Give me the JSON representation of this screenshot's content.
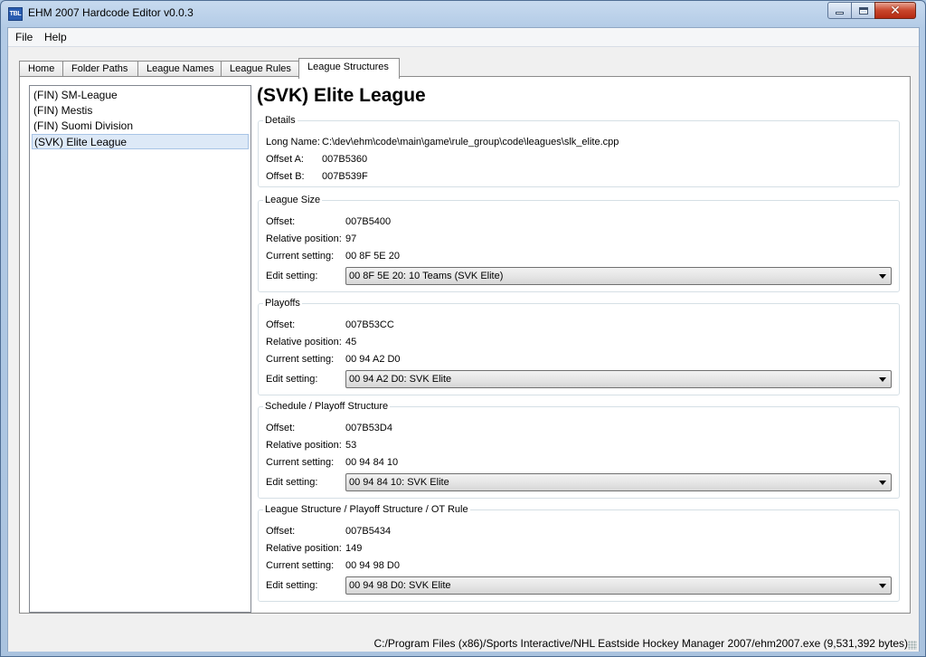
{
  "window": {
    "title": "EHM 2007 Hardcode Editor v0.0.3",
    "icon_name": "tbl-app-icon",
    "icon_text": "TBL"
  },
  "menu": {
    "file": "File",
    "help": "Help"
  },
  "tabs": [
    "Home",
    "Folder Paths",
    "League Names",
    "League Rules",
    "League Structures"
  ],
  "active_tab": "League Structures",
  "leagues": [
    "(FIN) SM-League",
    "(FIN) Mestis",
    "(FIN) Suomi Division",
    "(SVK) Elite League"
  ],
  "selected_league": "(SVK) Elite League",
  "detail": {
    "title": "(SVK) Elite League",
    "details_group": {
      "legend": "Details",
      "long_name_label": "Long Name:",
      "long_name": "C:\\dev\\ehm\\code\\main\\game\\rule_group\\code\\leagues\\slk_elite.cpp",
      "offset_a_label": "Offset A:",
      "offset_a": "007B5360",
      "offset_b_label": "Offset B:",
      "offset_b": "007B539F"
    },
    "labels": {
      "offset": "Offset:",
      "relative_position": "Relative position:",
      "current_setting": "Current setting:",
      "edit_setting": "Edit setting:"
    },
    "groups": [
      {
        "legend": "League Size",
        "offset": "007B5400",
        "relative_position": "97",
        "current_setting": "00 8F 5E 20",
        "edit_setting": "00 8F 5E 20: 10 Teams (SVK Elite)"
      },
      {
        "legend": "Playoffs",
        "offset": "007B53CC",
        "relative_position": "45",
        "current_setting": "00 94 A2 D0",
        "edit_setting": "00 94 A2 D0: SVK Elite"
      },
      {
        "legend": "Schedule / Playoff Structure",
        "offset": "007B53D4",
        "relative_position": "53",
        "current_setting": "00 94 84 10",
        "edit_setting": "00 94 84 10: SVK Elite"
      },
      {
        "legend": "League Structure / Playoff Structure / OT Rule",
        "offset": "007B5434",
        "relative_position": "149",
        "current_setting": "00 94 98 D0",
        "edit_setting": "00 94 98 D0: SVK Elite"
      }
    ]
  },
  "status": {
    "text": "C:/Program Files (x86)/Sports Interactive/NHL Eastside Hockey Manager 2007/ehm2007.exe (9,531,392 bytes)"
  }
}
